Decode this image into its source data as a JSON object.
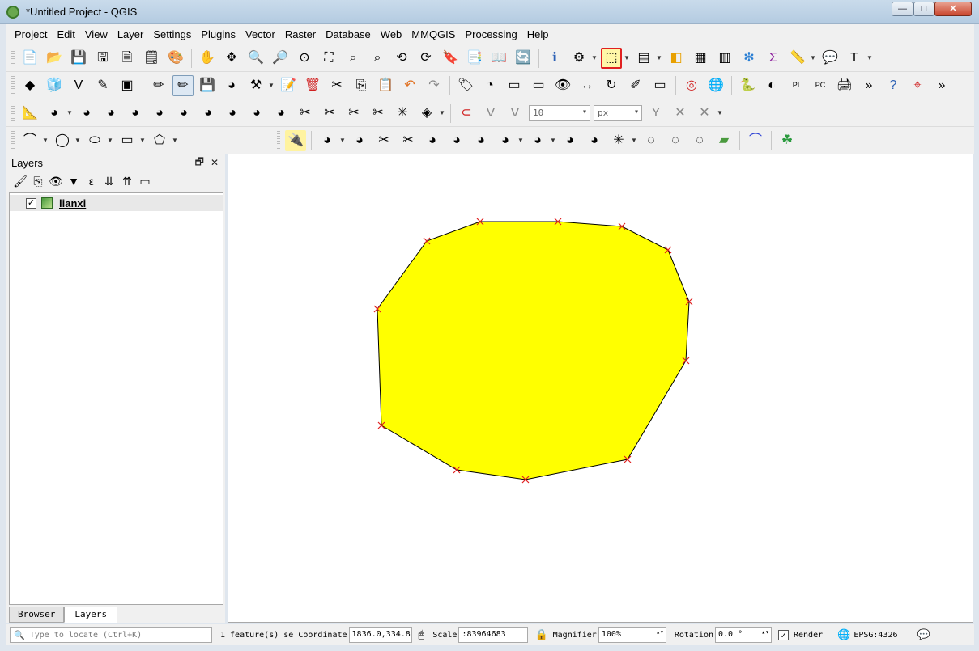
{
  "window": {
    "title": "*Untitled Project - QGIS",
    "buttons": {
      "minimize": "—",
      "maximize": "□",
      "close": "✕"
    }
  },
  "menu": [
    "Project",
    "Edit",
    "View",
    "Layer",
    "Settings",
    "Plugins",
    "Vector",
    "Raster",
    "Database",
    "Web",
    "MMQGIS",
    "Processing",
    "Help"
  ],
  "toolbar1": {
    "icons": [
      "new-project-icon",
      "open-project-icon",
      "save-project-icon",
      "save-as-icon",
      "new-print-layout-icon",
      "layout-manager-icon",
      "style-manager-icon",
      "pan-icon",
      "pan-to-selection-icon",
      "zoom-in-icon",
      "zoom-out-icon",
      "zoom-native-icon",
      "zoom-full-icon",
      "zoom-to-selection-icon",
      "zoom-to-layer-icon",
      "zoom-last-icon",
      "zoom-next-icon",
      "new-bookmark-icon",
      "show-bookmarks-icon",
      "refresh-icon",
      "identify-icon",
      "run-action-icon",
      "select-features-icon",
      "select-by-value-icon",
      "deselect-icon",
      "attribute-table-icon",
      "statistics-icon",
      "field-calculator-icon",
      "sum-icon",
      "measure-icon",
      "map-tips-icon",
      "text-annotation-icon"
    ]
  },
  "toolbar3": {
    "snap_tolerance": "10",
    "snap_unit": "px"
  },
  "layers_panel": {
    "title": "Layers",
    "float_btn": "🗗",
    "close_btn": "✕",
    "layers": [
      {
        "name": "lianxi",
        "checked": true
      }
    ],
    "tabs": [
      "Browser",
      "Layers"
    ]
  },
  "map": {
    "polygon_fill": "#ffff00",
    "polygon_stroke": "#000000",
    "vertex_color": "#e02020"
  },
  "status": {
    "locate_placeholder": "Type to locate (Ctrl+K)",
    "features_text": "1 feature(s) se",
    "coordinate_label": "Coordinate",
    "coordinate_value": "1836.0,334.8",
    "scale_label": "Scale",
    "scale_value": ":83964683",
    "magnifier_label": "Magnifier",
    "magnifier_value": "100%",
    "rotation_label": "Rotation",
    "rotation_value": "0.0 °",
    "render_label": "Render",
    "crs": "EPSG:4326"
  }
}
